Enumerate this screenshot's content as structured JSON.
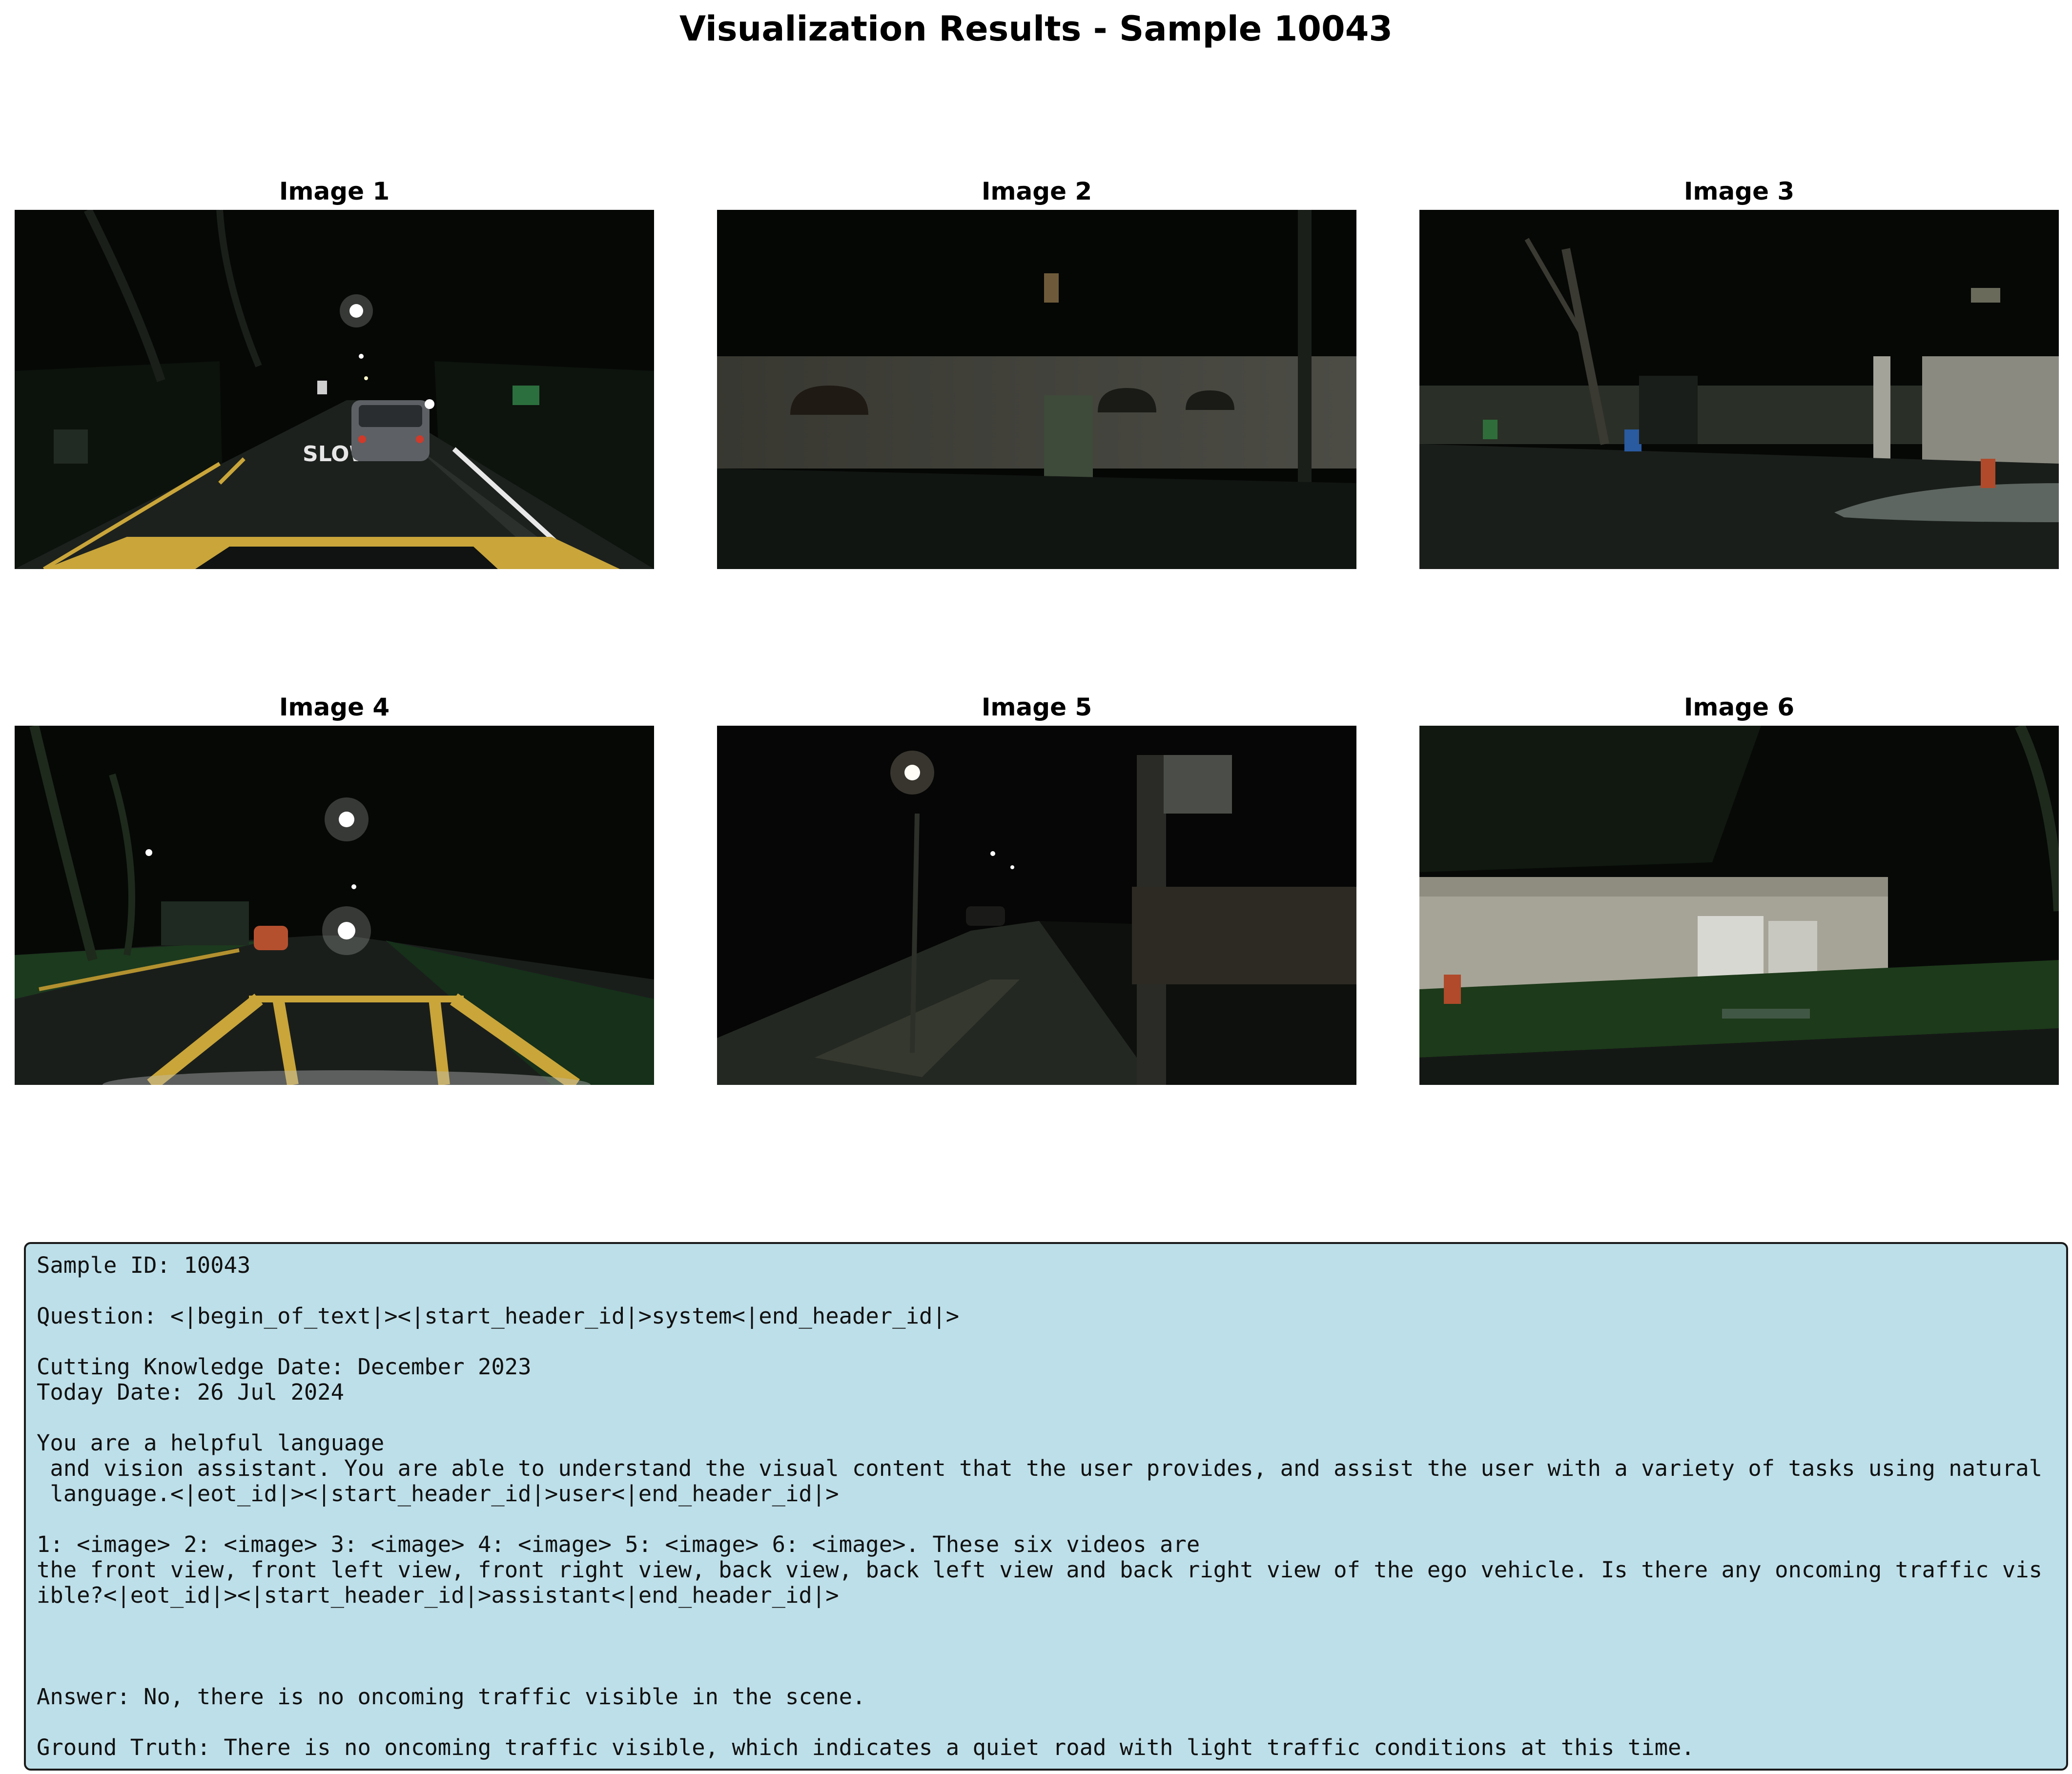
{
  "title": "Visualization Results - Sample 10043",
  "panels": [
    {
      "label": "Image 1",
      "scene": "front-view-night-road"
    },
    {
      "label": "Image 2",
      "scene": "front-left-view-wall"
    },
    {
      "label": "Image 3",
      "scene": "front-right-view-houses"
    },
    {
      "label": "Image 4",
      "scene": "back-view-road-streetlight"
    },
    {
      "label": "Image 5",
      "scene": "back-left-view-sidewalk"
    },
    {
      "label": "Image 6",
      "scene": "back-right-view-wall"
    }
  ],
  "road_marking": "SLOW",
  "info": {
    "sample_id": "Sample ID: 10043",
    "question_l1": "Question: <|begin_of_text|><|start_header_id|>system<|end_header_id|>",
    "cutting_date": "Cutting Knowledge Date: December 2023",
    "today_date": "Today Date: 26 Jul 2024",
    "sys_l1": "You are a helpful language",
    "sys_l2": " and vision assistant. You are able to understand the visual content that the user provides, and assist the user with a variety of tasks using natural",
    "sys_l3": " language.<|eot_id|><|start_header_id|>user<|end_header_id|>",
    "user_l1": "1: <image> 2: <image> 3: <image> 4: <image> 5: <image> 6: <image>. These six videos are",
    "user_l2": "the front view, front left view, front right view, back view, back left view and back right view of the ego vehicle. Is there any oncoming traffic vis",
    "user_l3": "ible?<|eot_id|><|start_header_id|>assistant<|end_header_id|>",
    "answer": "Answer: No, there is no oncoming traffic visible in the scene.",
    "ground_truth": "Ground Truth: There is no oncoming traffic visible, which indicates a quiet road with light traffic conditions at this time."
  },
  "colors": {
    "info_bg": "#bddfe9",
    "road_yellow": "#c9a53a",
    "night_dark": "#070a07"
  }
}
